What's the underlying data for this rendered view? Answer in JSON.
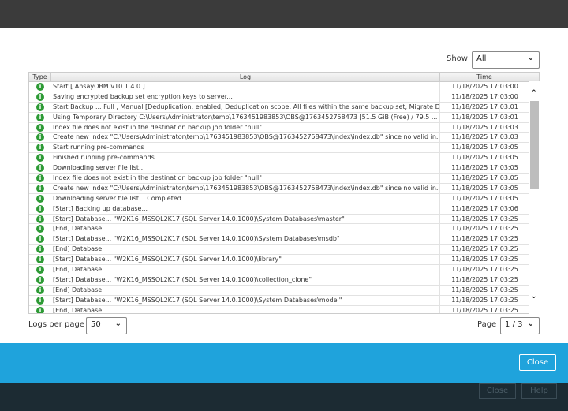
{
  "show": {
    "label": "Show",
    "value": "All"
  },
  "columns": [
    "Type",
    "Log",
    "Time"
  ],
  "rows": [
    [
      "Start [ AhsayOBM v10.1.4.0 ]",
      "11/18/2025 17:03:00"
    ],
    [
      "Saving encrypted backup set encryption keys to server...",
      "11/18/2025 17:03:00"
    ],
    [
      "Start Backup ... Full , Manual [Deduplication: enabled, Deduplication scope: All files within the same backup set, Migrate D...",
      "11/18/2025 17:03:01"
    ],
    [
      "Using Temporary Directory C:\\Users\\Administrator\\temp\\1763451983853\\OBS@1763452758473 [51.5 GiB (Free) / 79.5 ...",
      "11/18/2025 17:03:01"
    ],
    [
      "Index file does not exist in the destination backup job folder \"null\"",
      "11/18/2025 17:03:03"
    ],
    [
      "Create new index \"C:\\Users\\Administrator\\temp\\1763451983853\\OBS@1763452758473\\index\\index.db\" since no valid in...",
      "11/18/2025 17:03:03"
    ],
    [
      "Start running pre-commands",
      "11/18/2025 17:03:05"
    ],
    [
      "Finished running pre-commands",
      "11/18/2025 17:03:05"
    ],
    [
      "Downloading server file list...",
      "11/18/2025 17:03:05"
    ],
    [
      "Index file does not exist in the destination backup job folder \"null\"",
      "11/18/2025 17:03:05"
    ],
    [
      "Create new index \"C:\\Users\\Administrator\\temp\\1763451983853\\OBS@1763452758473\\index\\index.db\" since no valid in...",
      "11/18/2025 17:03:05"
    ],
    [
      "Downloading server file list... Completed",
      "11/18/2025 17:03:05"
    ],
    [
      "[Start] Backing up database...",
      "11/18/2025 17:03:06"
    ],
    [
      "[Start] Database... \"W2K16_MSSQL2K17 (SQL Server 14.0.1000)\\System Databases\\master\"",
      "11/18/2025 17:03:25"
    ],
    [
      "[End] Database",
      "11/18/2025 17:03:25"
    ],
    [
      "[Start] Database... \"W2K16_MSSQL2K17 (SQL Server 14.0.1000)\\System Databases\\msdb\"",
      "11/18/2025 17:03:25"
    ],
    [
      "[End] Database",
      "11/18/2025 17:03:25"
    ],
    [
      "[Start] Database... \"W2K16_MSSQL2K17 (SQL Server 14.0.1000)\\library\"",
      "11/18/2025 17:03:25"
    ],
    [
      "[End] Database",
      "11/18/2025 17:03:25"
    ],
    [
      "[Start] Database... \"W2K16_MSSQL2K17 (SQL Server 14.0.1000)\\collection_clone\"",
      "11/18/2025 17:03:25"
    ],
    [
      "[End] Database",
      "11/18/2025 17:03:25"
    ],
    [
      "[Start] Database... \"W2K16_MSSQL2K17 (SQL Server 14.0.1000)\\System Databases\\model\"",
      "11/18/2025 17:03:25"
    ],
    [
      "[End] Database",
      "11/18/2025 17:03:25"
    ]
  ],
  "row_icon": "info-icon",
  "logs_per_page": {
    "label": "Logs per page",
    "value": "50"
  },
  "page": {
    "label": "Page",
    "value": "1 / 3"
  },
  "close_label": "Close",
  "background_buttons": [
    "Close",
    "Help"
  ],
  "colors": {
    "accent": "#1fa3dc",
    "info": "#2d9a35"
  }
}
